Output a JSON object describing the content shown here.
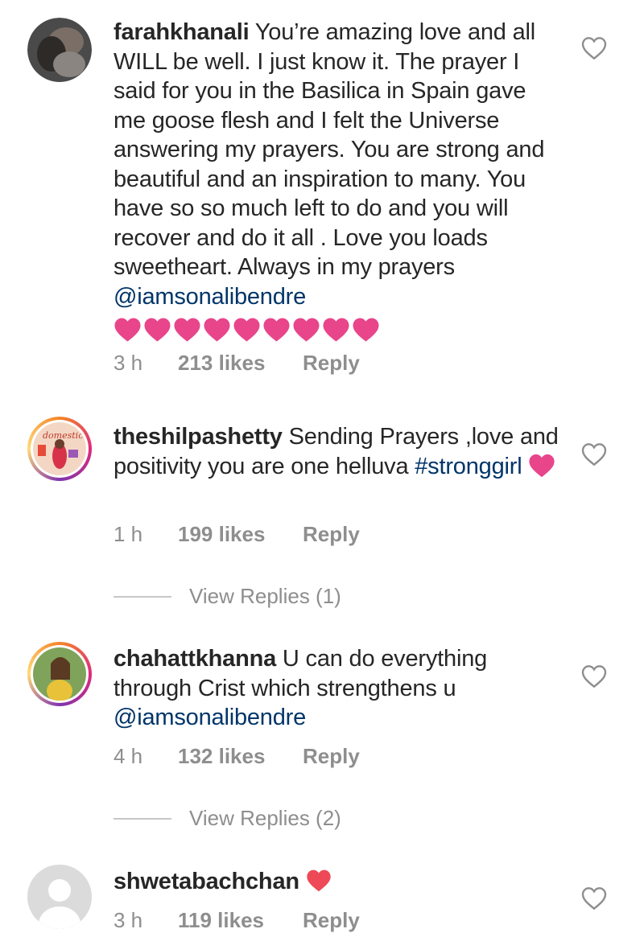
{
  "comments": [
    {
      "username": "farahkhanali",
      "text": "You’re amazing love and all WILL be well. I just know it. The prayer I said for you in the Basilica in Spain gave me goose flesh and I felt the Universe answering my prayers. You are strong and beautiful and an inspiration to many. You have so so much left to do and you will recover and do it all . Love you loads sweetheart. Always in my prayers",
      "mention": "@iamsonalibendre",
      "emoji": "❤❤❤❤❤❤❤❤❤",
      "time": "3 h",
      "likes": "213 likes",
      "reply": "Reply"
    },
    {
      "username": "theshilpashetty",
      "text": "Sending Prayers ,love and positivity you are one helluva",
      "hashtag": "#stronggirl",
      "emoji": "💖",
      "time": "1 h",
      "likes": "199 likes",
      "reply": "Reply",
      "view_replies": "View Replies (1)"
    },
    {
      "username": "chahattkhanna",
      "text": "U can do everything through Crist which strengthens u",
      "mention": "@iamsonalibendre",
      "time": "4 h",
      "likes": "132 likes",
      "reply": "Reply",
      "view_replies": "View Replies (2)"
    },
    {
      "username": "shwetabachchan",
      "emoji": "❤",
      "time": "3 h",
      "likes": "119 likes",
      "reply": "Reply"
    }
  ],
  "colors": {
    "heart": "#ed4956",
    "pink_heart": "#e8458b",
    "link": "#003569",
    "meta": "#8e8e8e"
  }
}
